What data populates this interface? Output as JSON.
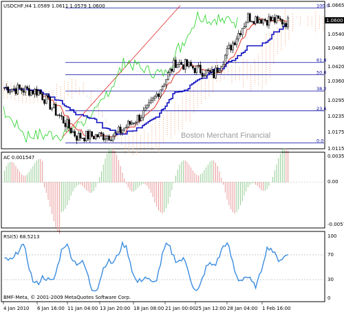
{
  "header": {
    "symbol": "USDCHF,H4",
    "ohlc": "1.0589 1.0611 1.0579 1.0600",
    "watermark": "Boston Merchant Financial",
    "copyright": "BMF-Meta, © 2001-2009 MetaQuotes Software Corp."
  },
  "price_panel": {
    "current_price": "1.0600",
    "y_ticks": [
      "1.0665",
      "1.0540",
      "1.0480",
      "1.0420",
      "1.0360",
      "1.0295",
      "1.0235",
      "1.0175",
      "1.0115"
    ],
    "fib_levels": [
      {
        "label": "100.0",
        "price": 1.0655
      },
      {
        "label": "61.8",
        "price": 1.0443
      },
      {
        "label": "50.0",
        "price": 1.0395
      },
      {
        "label": "38.2",
        "price": 1.0332
      },
      {
        "label": "23.6",
        "price": 1.0255
      },
      {
        "label": "0.0",
        "price": 1.013
      }
    ]
  },
  "ac_panel": {
    "label": "AC 0.001547",
    "y_ticks": [
      "0.00359",
      "0.00",
      "-0.00578"
    ]
  },
  "rsi_panel": {
    "label": "RSI(5) 68.5213",
    "y_ticks": [
      "100",
      "70",
      "30",
      "0"
    ]
  },
  "x_axis": {
    "ticks": [
      "4 Jan 2010",
      "6 Jan 16:00",
      "11 Jan 04:00",
      "13 Jan 20:00",
      "18 Jan 08:00",
      "21 Jan 00:00",
      "25 Jan 12:00",
      "28 Jan 04:00",
      "1 Feb 16:00"
    ]
  },
  "colors": {
    "bull": "#2a9a2a",
    "bear": "#d03030",
    "kijun": "#1010c0",
    "tenkan": "#e03020",
    "chikou": "#20d020",
    "rsi": "#3a8ce0",
    "fib": "#0000a0",
    "cloud_up": "#f0a070",
    "cloud_down": "#c08090"
  },
  "chart_data": [
    {
      "type": "line",
      "title": "USDCHF,H4",
      "ylim": [
        1.0115,
        1.0665
      ],
      "x": [
        "4 Jan 2010",
        "6 Jan 16:00",
        "11 Jan 04:00",
        "13 Jan 20:00",
        "18 Jan 08:00",
        "21 Jan 00:00",
        "25 Jan 12:00",
        "28 Jan 04:00",
        "1 Feb 16:00"
      ],
      "series": [
        {
          "values": [
            1.0345,
            1.033,
            1.0155,
            1.016,
            1.0255,
            1.0445,
            1.0395,
            1.062,
            1.06
          ]
        }
      ]
    },
    {
      "type": "bar",
      "title": "AC 0.001547",
      "ylim": [
        -0.00578,
        0.00359
      ]
    },
    {
      "type": "line",
      "title": "RSI(5) 68.5213",
      "ylim": [
        0,
        100
      ]
    }
  ]
}
